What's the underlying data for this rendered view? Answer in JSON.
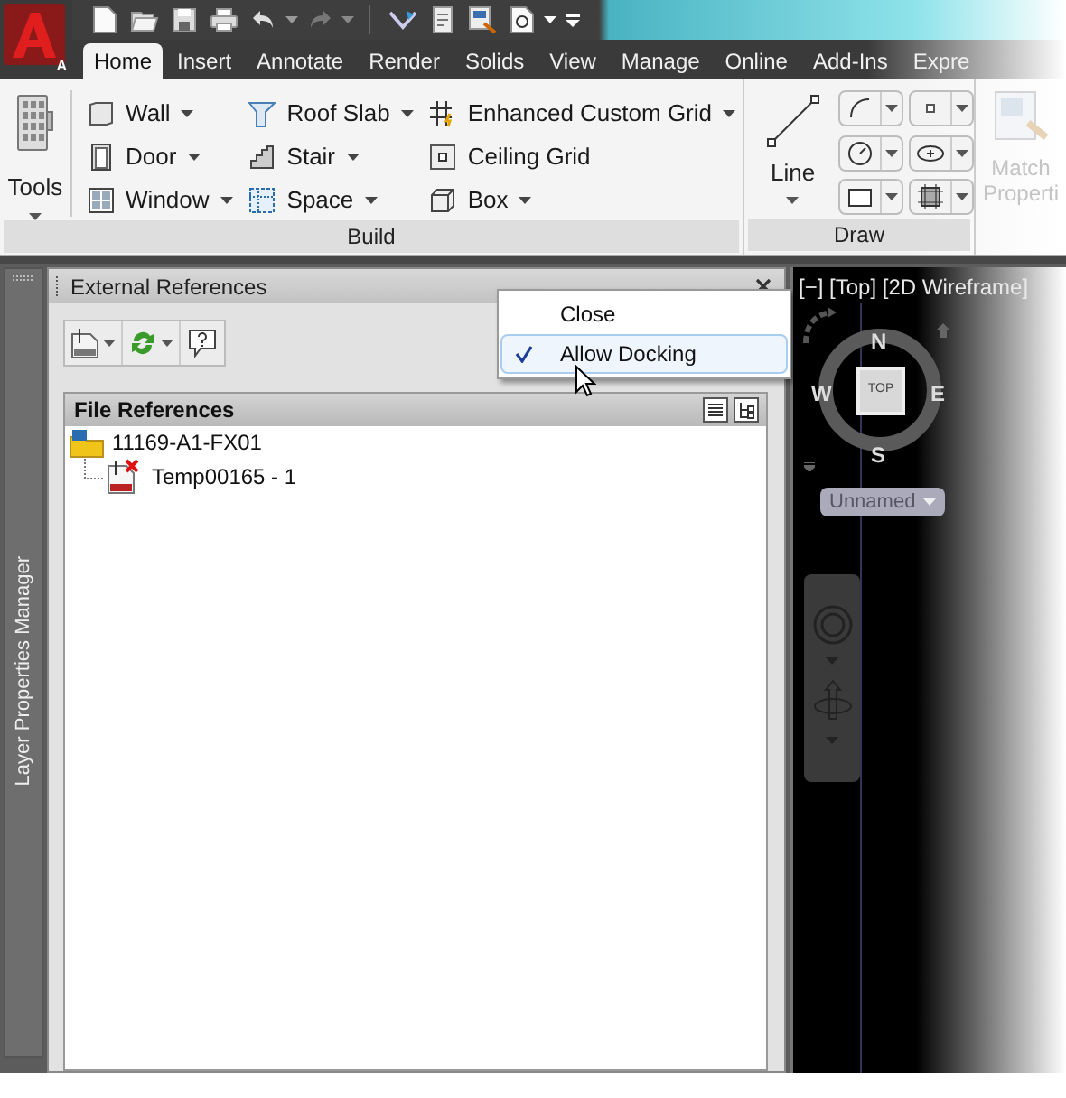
{
  "app_menu": {
    "letter": "A"
  },
  "quick_access": {
    "redo_disabled": true
  },
  "tabs": [
    {
      "label": "Home",
      "selected": true
    },
    {
      "label": "Insert",
      "selected": false
    },
    {
      "label": "Annotate",
      "selected": false
    },
    {
      "label": "Render",
      "selected": false
    },
    {
      "label": "Solids",
      "selected": false
    },
    {
      "label": "View",
      "selected": false
    },
    {
      "label": "Manage",
      "selected": false
    },
    {
      "label": "Online",
      "selected": false
    },
    {
      "label": "Add-Ins",
      "selected": false
    },
    {
      "label": "Expre",
      "selected": false
    }
  ],
  "ribbon": {
    "tools": {
      "label": "Tools"
    },
    "build": {
      "title": "Build",
      "columns": [
        [
          {
            "label": "Wall",
            "dropdown": true
          },
          {
            "label": "Door",
            "dropdown": true
          },
          {
            "label": "Window",
            "dropdown": true
          }
        ],
        [
          {
            "label": "Roof Slab",
            "dropdown": true
          },
          {
            "label": "Stair",
            "dropdown": true
          },
          {
            "label": "Space",
            "dropdown": true
          }
        ],
        [
          {
            "label": "Enhanced Custom Grid",
            "dropdown": true
          },
          {
            "label": "Ceiling Grid",
            "dropdown": false
          },
          {
            "label": "Box",
            "dropdown": true
          }
        ]
      ]
    },
    "draw": {
      "title": "Draw",
      "line_label": "Line"
    },
    "match": {
      "lines": [
        "Match",
        "Properti"
      ],
      "disabled": true
    }
  },
  "side_tab": {
    "label": "Layer Properties Manager"
  },
  "palette": {
    "title": "External References",
    "section": "File References",
    "tree": [
      {
        "label": "11169-A1-FX01",
        "children": [
          {
            "label": "Temp00165 - 1"
          }
        ]
      }
    ]
  },
  "context_menu": [
    {
      "label": "Close",
      "checked": false,
      "selected": false
    },
    {
      "label": "Allow Docking",
      "checked": true,
      "selected": true
    }
  ],
  "viewport": {
    "label": "[−] [Top] [2D Wireframe]",
    "compass": {
      "north": "N",
      "south": "S",
      "east": "E",
      "west": "W",
      "cube": "TOP"
    },
    "view_style": "Unnamed"
  }
}
